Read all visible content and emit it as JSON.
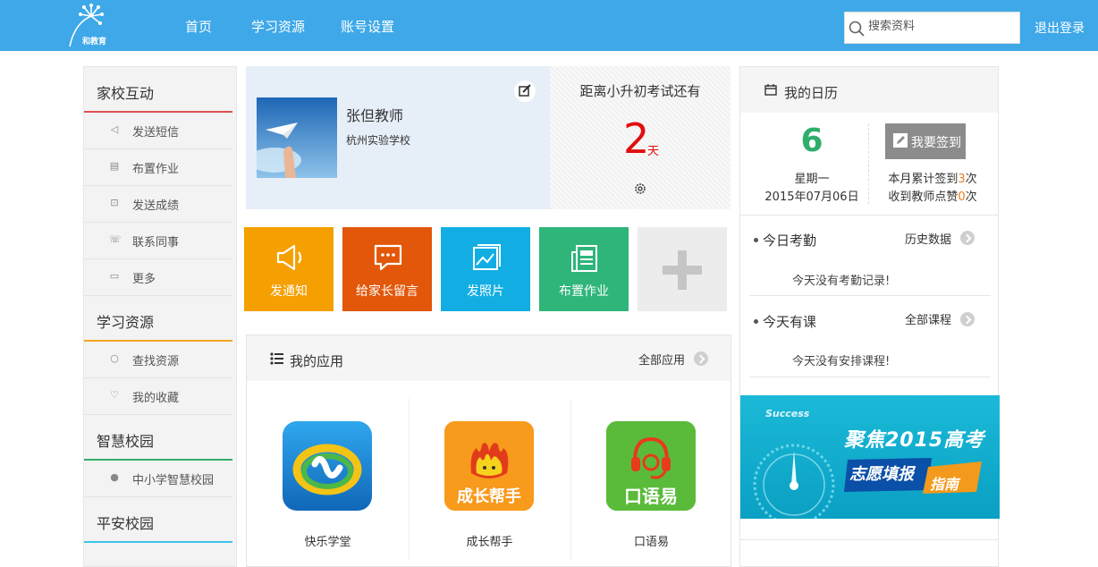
{
  "header": {
    "logo_text": "和教育",
    "nav": [
      "首页",
      "学习资源",
      "账号设置"
    ],
    "search_placeholder": "搜索资料",
    "logout": "退出登录"
  },
  "sidebar": {
    "sections": [
      {
        "title": "家校互动",
        "color": "#e05050",
        "items": [
          "发送短信",
          "布置作业",
          "发送成绩",
          "联系同事",
          "更多"
        ]
      },
      {
        "title": "学习资源",
        "color": "#f5a623",
        "items": [
          "查找资源",
          "我的收藏"
        ]
      },
      {
        "title": "智慧校园",
        "color": "#2fae6a",
        "items": [
          "中小学智慧校园"
        ]
      },
      {
        "title": "平安校园",
        "color": "#3ec4e8",
        "items": []
      }
    ]
  },
  "profile": {
    "name": "张但教师",
    "school": "杭州实验学校"
  },
  "countdown": {
    "title": "距离小升初考试还有",
    "value": "2",
    "unit": "天"
  },
  "tiles": [
    {
      "label": "发通知",
      "color": "#f59f00",
      "icon": "megaphone-icon"
    },
    {
      "label": "给家长留言",
      "color": "#e2570a",
      "icon": "message-icon"
    },
    {
      "label": "发照片",
      "color": "#12aee3",
      "icon": "photo-icon"
    },
    {
      "label": "布置作业",
      "color": "#2fb57a",
      "icon": "homework-icon"
    },
    {
      "label": "",
      "color": "#ececec",
      "icon": "plus-icon"
    }
  ],
  "apps": {
    "title": "我的应用",
    "all_link": "全部应用",
    "items": [
      {
        "label": "快乐学堂",
        "icon": "kuaile-xuetang-icon"
      },
      {
        "label": "成长帮手",
        "icon": "chengzhang-bangshou-icon",
        "icon_text": "成长帮手"
      },
      {
        "label": "口语易",
        "icon": "kouyuyi-icon",
        "icon_text": "口语易"
      }
    ]
  },
  "calendar": {
    "title": "我的日历",
    "day": "6",
    "weekday": "星期一",
    "date": "2015年07月06日",
    "sign_button": "我要签到",
    "stat1_pre": "本月累计签到",
    "stat1_num": "3",
    "stat1_post": "次",
    "stat2_pre": "收到教师点赞",
    "stat2_num": "0",
    "stat2_post": "次",
    "attendance_title": "今日考勤",
    "attendance_link": "历史数据",
    "attendance_msg": "今天没有考勤记录!",
    "course_title": "今天有课",
    "course_link": "全部课程",
    "course_msg": "今天没有安排课程!"
  },
  "banner": {
    "success": "Success",
    "line1": "聚焦2015高考",
    "line2": "志愿填报",
    "line3": "指南"
  }
}
